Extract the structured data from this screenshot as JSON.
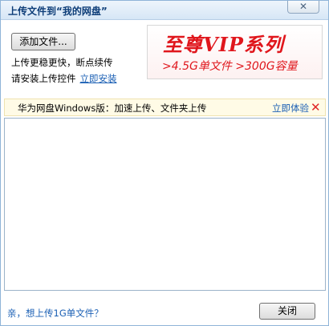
{
  "window": {
    "title": "上传文件到“我的网盘”",
    "close_glyph": "✕"
  },
  "upload": {
    "add_button_label": "添加文件...",
    "tip_line": "上传更稳更快，断点续传",
    "install_prompt": "请安装上传控件",
    "install_link": "立即安装"
  },
  "vip_banner": {
    "title": "至尊VIP系列",
    "subtitle": ">4.5G单文件 >300G容量",
    "accent_color": "#e0161c"
  },
  "promo": {
    "text": "华为网盘Windows版：加速上传、文件夹上传",
    "link": "立即体验",
    "close_glyph": "✕"
  },
  "file_list": {
    "items": []
  },
  "footer": {
    "link": "亲，想上传1G单文件？",
    "close_button_label": "关闭"
  }
}
